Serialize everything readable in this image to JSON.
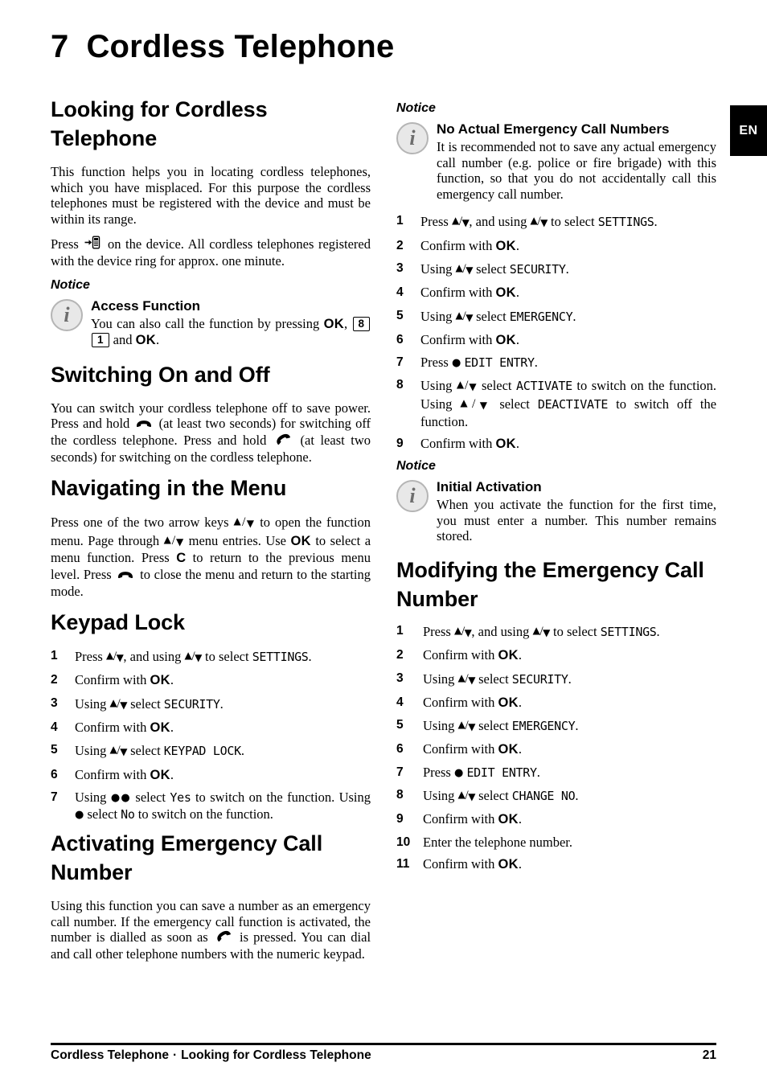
{
  "chapter": {
    "number": "7",
    "title": "Cordless Telephone"
  },
  "lang_tab": {
    "label": "EN"
  },
  "glyphs": {
    "ok": "OK",
    "c_key": "C",
    "arrow_up": "▲",
    "arrow_down": "▼",
    "slash": "/",
    "dot_one": "●",
    "dot_two": "●●",
    "key_8": "8",
    "key_1": "1"
  },
  "left_column": {
    "section1": {
      "heading": "Looking for Cordless Telephone",
      "para1": "This function helps you in locating cordless telephones, which you have misplaced. For this purpose the cordless telephones must be registered with the device and must be within its range.",
      "para2_before": "Press",
      "para2_after": "on the device. All cordless telephones registered with the device ring for approx. one minute.",
      "notice": {
        "label": "Notice",
        "title": "Access Function",
        "text_before": "You can also call the function by pressing",
        "text_middle": ",",
        "text_after": "and",
        "text_end": "."
      }
    },
    "section2": {
      "heading": "Switching On and Off",
      "para_1": "You can switch your cordless telephone off to save power. Press and hold",
      "para_2": "(at least two seconds) for switching off the cordless telephone. Press and hold",
      "para_3": "(at least two seconds) for switching on the cordless telephone."
    },
    "section3": {
      "heading": "Navigating in the Menu",
      "para_1": "Press one of the two arrow keys",
      "para_2": "to open the function menu. Page through",
      "para_3": "menu entries. Use",
      "para_4": "to select a menu function. Press",
      "para_5": "to return to the previous menu level. Press",
      "para_6": "to close the menu and return to the starting mode."
    },
    "section4": {
      "heading": "Keypad Lock",
      "steps": [
        {
          "before": "Press",
          "after": ", and using",
          "after2": "to select",
          "lcd": "SETTINGS",
          "end": "."
        },
        {
          "before": "Confirm with",
          "ok": true,
          "end": "."
        },
        {
          "before": "Using",
          "after2": "select",
          "lcd": "SECURITY",
          "end": "."
        },
        {
          "before": "Confirm with",
          "ok": true,
          "end": "."
        },
        {
          "before": "Using",
          "after2": "select",
          "lcd": "KEYPAD LOCK",
          "end": "."
        },
        {
          "before": "Confirm with",
          "ok": true,
          "end": "."
        },
        {
          "text_a": "Using",
          "text_b": "select",
          "lcd_a": "Yes",
          "text_c": "to switch on the function. Using",
          "text_d": "select",
          "lcd_b": "No",
          "text_e": "to switch on the function."
        }
      ]
    },
    "section5": {
      "heading": "Activating Emergency Call Number",
      "para_1": "Using this function you can save a number as an emergency call number. If the emergency call function is activated, the number is dialled as soon as",
      "para_2": "is pressed. You can dial and call other telephone numbers with the numeric keypad."
    }
  },
  "right_column": {
    "notice_top": {
      "label": "Notice",
      "title": "No Actual Emergency Call Numbers",
      "text": "It is recommended not to save any actual emergency call number (e.g. police or fire brigade) with this function, so that you do not accidentally call this emergency call number."
    },
    "steps_activating": [
      {
        "before": "Press",
        "after": ", and using",
        "after2": "to select",
        "lcd": "SETTINGS",
        "end": "."
      },
      {
        "before": "Confirm with",
        "ok": true,
        "end": "."
      },
      {
        "before": "Using",
        "after2": "select",
        "lcd": "SECURITY",
        "end": "."
      },
      {
        "before": "Confirm with",
        "ok": true,
        "end": "."
      },
      {
        "before": "Using",
        "after2": "select",
        "lcd": "EMERGENCY",
        "end": "."
      },
      {
        "before": "Confirm with",
        "ok": true,
        "end": "."
      },
      {
        "press_dot": "Press",
        "lcd": "EDIT ENTRY",
        "end": "."
      },
      {
        "text_a": "Using",
        "text_b": "select",
        "lcd_a": "ACTIVATE",
        "text_c": "to switch on the function. Using",
        "text_d": "select",
        "lcd_b": "DEACTIVATE",
        "text_e": "to switch off the function."
      },
      {
        "before": "Confirm with",
        "ok": true,
        "end": "."
      }
    ],
    "notice_bottom": {
      "label": "Notice",
      "title": "Initial Activation",
      "text": "When you activate the function for the first time, you must enter a number. This number remains stored."
    },
    "section_modifying": {
      "heading": "Modifying the Emergency Call Number",
      "steps": [
        {
          "before": "Press",
          "after": ", and using",
          "after2": "to select",
          "lcd": "SETTINGS",
          "end": "."
        },
        {
          "before": "Confirm with",
          "ok": true,
          "end": "."
        },
        {
          "before": "Using",
          "after2": "select",
          "lcd": "SECURITY",
          "end": "."
        },
        {
          "before": "Confirm with",
          "ok": true,
          "end": "."
        },
        {
          "before": "Using",
          "after2": "select",
          "lcd": "EMERGENCY",
          "end": "."
        },
        {
          "before": "Confirm with",
          "ok": true,
          "end": "."
        },
        {
          "press_dot": "Press",
          "lcd": "EDIT ENTRY",
          "end": "."
        },
        {
          "before": "Using",
          "after2": "select",
          "lcd": "CHANGE NO",
          "end": "."
        },
        {
          "before": "Confirm with",
          "ok": true,
          "end": "."
        },
        {
          "plain": "Enter the telephone number."
        },
        {
          "before": "Confirm with",
          "ok": true,
          "end": "."
        }
      ]
    }
  },
  "footer": {
    "left_primary": "Cordless Telephone",
    "separator": "·",
    "left_secondary": "Looking for Cordless Telephone",
    "page_number": "21"
  }
}
